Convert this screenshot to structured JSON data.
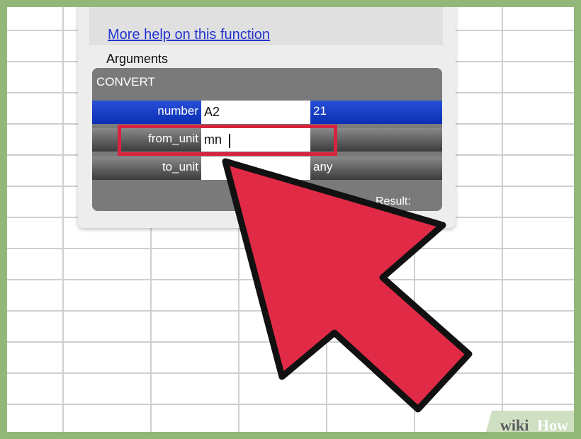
{
  "dialog": {
    "help_link": "More help on this function",
    "arguments_label": "Arguments",
    "function_name": "CONVERT",
    "arguments": [
      {
        "label": "number",
        "input": "A2",
        "value": "21"
      },
      {
        "label": "from_unit",
        "input": "mn",
        "value": ""
      },
      {
        "label": "to_unit",
        "input": "",
        "value": "any"
      }
    ],
    "result_label": "Result:"
  },
  "watermark": {
    "wiki": "wiki",
    "how": "How"
  },
  "colors": {
    "highlight": "#d6243f",
    "arrow": "#e12a45",
    "selected_row": "#1f45cf",
    "border_green": "#93b778"
  },
  "icons": {
    "pointer": "red-arrow-pointer-icon"
  }
}
